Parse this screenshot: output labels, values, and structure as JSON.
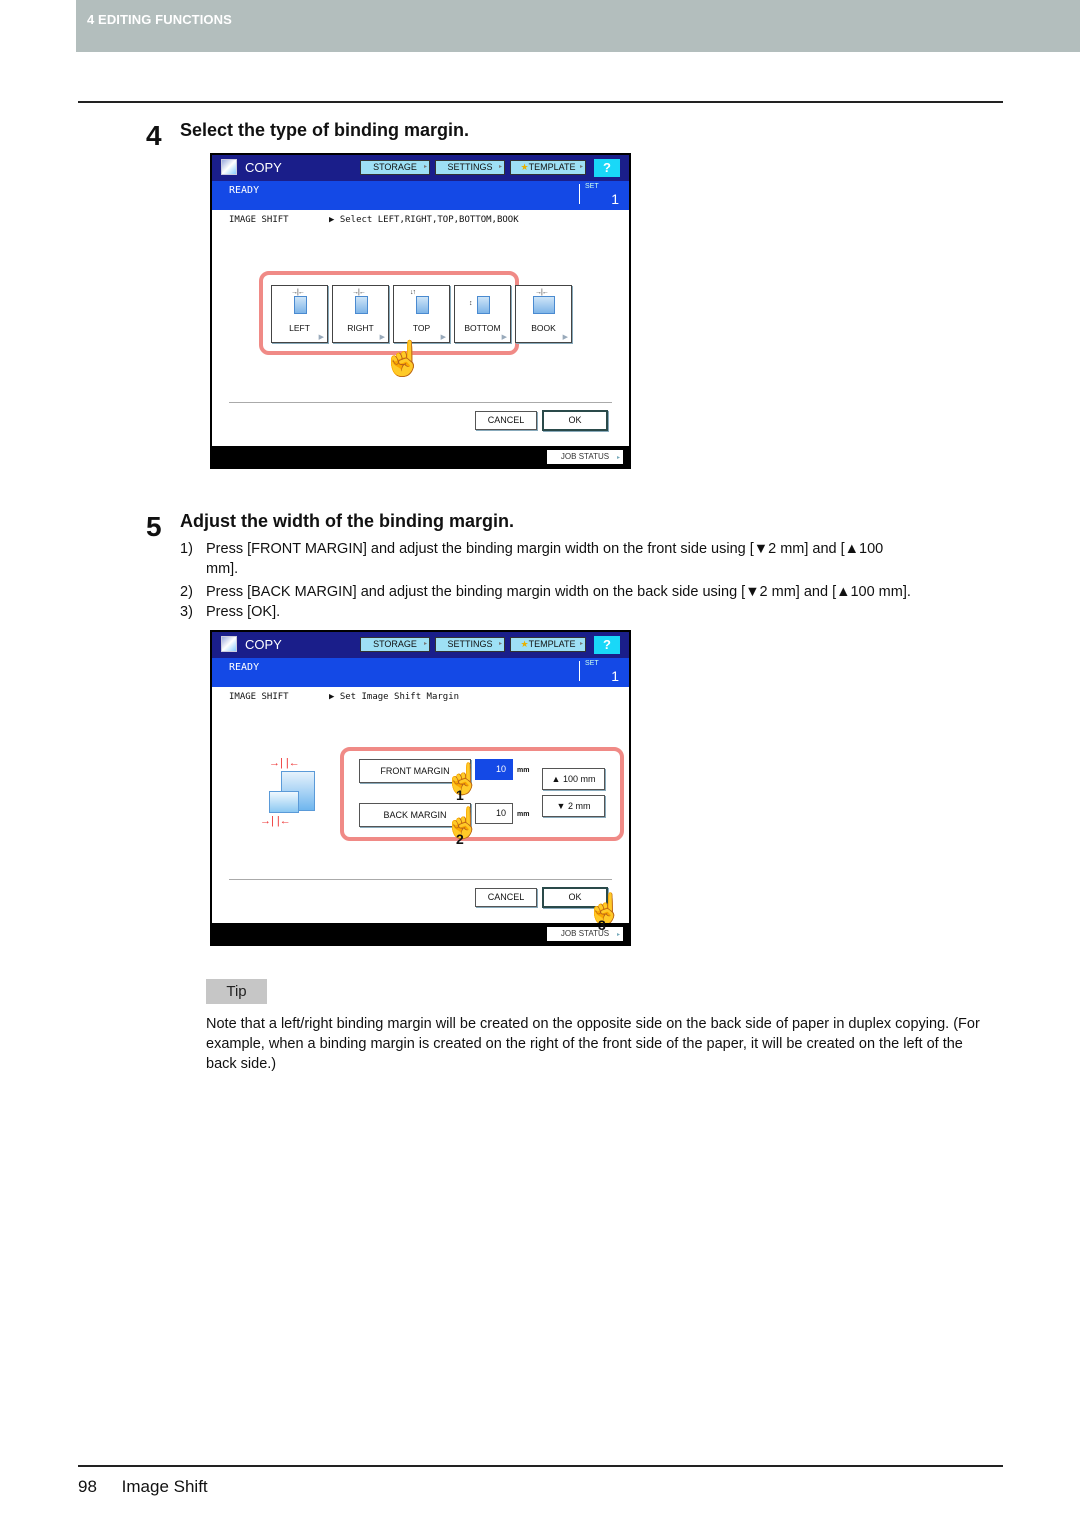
{
  "chapter_header": "4 EDITING FUNCTIONS",
  "step4": {
    "number": "4",
    "title": "Select the type of binding margin."
  },
  "panel1": {
    "title": "COPY",
    "tabs": [
      "STORAGE",
      "SETTINGS",
      "TEMPLATE"
    ],
    "help": "?",
    "status": "READY",
    "set_label": "SET",
    "set_value": "1",
    "function": "IMAGE SHIFT",
    "message": "▶ Select LEFT,RIGHT,TOP,BOTTOM,BOOK",
    "types": [
      "LEFT",
      "RIGHT",
      "TOP",
      "BOTTOM",
      "BOOK"
    ],
    "cancel": "CANCEL",
    "ok": "OK",
    "job_status": "JOB STATUS"
  },
  "step5": {
    "number": "5",
    "title": "Adjust the width of the binding margin.",
    "instructions": [
      {
        "n": "1)",
        "text": "Press [FRONT MARGIN] and adjust the binding margin width on the front side using [▼2 mm] and [▲100",
        "cont": "mm]."
      },
      {
        "n": "2)",
        "text": "Press [BACK MARGIN] and adjust the binding margin width on the back side using [▼2 mm] and [▲100 mm]."
      },
      {
        "n": "3)",
        "text": "Press [OK]."
      }
    ]
  },
  "panel2": {
    "title": "COPY",
    "tabs": [
      "STORAGE",
      "SETTINGS",
      "TEMPLATE"
    ],
    "help": "?",
    "status": "READY",
    "set_label": "SET",
    "set_value": "1",
    "function": "IMAGE SHIFT",
    "message": "▶ Set Image Shift Margin",
    "front_margin": "FRONT MARGIN",
    "front_value": "10",
    "back_margin": "BACK MARGIN",
    "back_value": "10",
    "unit": "mm",
    "up_btn": "▲  100 mm",
    "down_btn": "▼      2 mm",
    "cancel": "CANCEL",
    "ok": "OK",
    "job_status": "JOB STATUS",
    "callouts": [
      "1",
      "2",
      "3"
    ]
  },
  "tip": {
    "label": "Tip",
    "text": "Note that a left/right binding margin will be created on the opposite side on the back side of paper in duplex copying. (For example, when a binding margin is created on the right of the front side of the paper, it will be created on the left of the back side.)"
  },
  "footer": {
    "page": "98",
    "section": "Image Shift"
  },
  "colors": {
    "header_bar": "#1a1e8a",
    "status_bar": "#1449e6",
    "tab_button": "#9ee0f5",
    "help_button": "#19d8f8",
    "highlight": "#f08a86",
    "active_value": "#1449e6",
    "chapter_bar": "#b3bebd"
  }
}
